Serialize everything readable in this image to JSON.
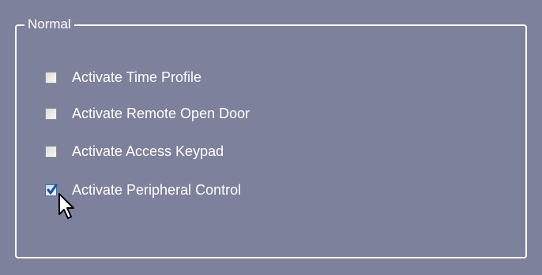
{
  "groupbox": {
    "title": "Normal"
  },
  "options": [
    {
      "label": "Activate Time Profile",
      "checked": false
    },
    {
      "label": "Activate Remote Open Door",
      "checked": false
    },
    {
      "label": "Activate Access Keypad",
      "checked": false
    },
    {
      "label": "Activate Peripheral Control",
      "checked": true
    }
  ],
  "colors": {
    "panel_background": "#7e819b",
    "text": "#ffffff",
    "border": "#ffffff",
    "check_accent": "#1f4f99"
  },
  "icons": {
    "checkmark": "check-icon",
    "cursor": "mouse-cursor-icon"
  }
}
